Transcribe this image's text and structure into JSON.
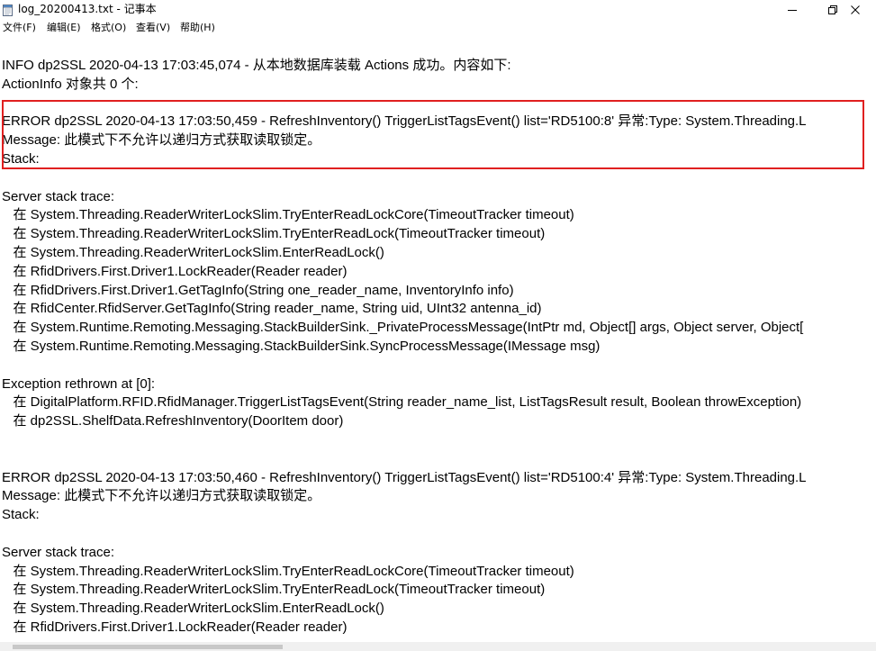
{
  "window": {
    "title": "log_20200413.txt - 记事本"
  },
  "menu": {
    "items": [
      {
        "label": "文件(F)"
      },
      {
        "label": "编辑(E)"
      },
      {
        "label": "格式(O)"
      },
      {
        "label": "查看(V)"
      },
      {
        "label": "帮助(H)"
      }
    ]
  },
  "icons": {
    "app": "notepad-icon",
    "minimize": "minimize-icon",
    "maximize": "maximize-icon",
    "close": "close-icon"
  },
  "colors": {
    "highlight_border": "#e02020",
    "text": "#000000",
    "background": "#ffffff"
  },
  "content": {
    "lines": [
      "INFO dp2SSL 2020-04-13 17:03:45,074 - 从本地数据库装载 Actions 成功。内容如下:",
      "ActionInfo 对象共 0 个:",
      "",
      "ERROR dp2SSL 2020-04-13 17:03:50,459 - RefreshInventory() TriggerListTagsEvent() list='RD5100:8' 异常:Type: System.Threading.L",
      "Message: 此模式下不允许以递归方式获取读取锁定。",
      "Stack:",
      "",
      "Server stack trace:",
      "   在 System.Threading.ReaderWriterLockSlim.TryEnterReadLockCore(TimeoutTracker timeout)",
      "   在 System.Threading.ReaderWriterLockSlim.TryEnterReadLock(TimeoutTracker timeout)",
      "   在 System.Threading.ReaderWriterLockSlim.EnterReadLock()",
      "   在 RfidDrivers.First.Driver1.LockReader(Reader reader)",
      "   在 RfidDrivers.First.Driver1.GetTagInfo(String one_reader_name, InventoryInfo info)",
      "   在 RfidCenter.RfidServer.GetTagInfo(String reader_name, String uid, UInt32 antenna_id)",
      "   在 System.Runtime.Remoting.Messaging.StackBuilderSink._PrivateProcessMessage(IntPtr md, Object[] args, Object server, Object[",
      "   在 System.Runtime.Remoting.Messaging.StackBuilderSink.SyncProcessMessage(IMessage msg)",
      "",
      "Exception rethrown at [0]:",
      "   在 DigitalPlatform.RFID.RfidManager.TriggerListTagsEvent(String reader_name_list, ListTagsResult result, Boolean throwException)",
      "   在 dp2SSL.ShelfData.RefreshInventory(DoorItem door)",
      "",
      "",
      "ERROR dp2SSL 2020-04-13 17:03:50,460 - RefreshInventory() TriggerListTagsEvent() list='RD5100:4' 异常:Type: System.Threading.L",
      "Message: 此模式下不允许以递归方式获取读取锁定。",
      "Stack:",
      "",
      "Server stack trace:",
      "   在 System.Threading.ReaderWriterLockSlim.TryEnterReadLockCore(TimeoutTracker timeout)",
      "   在 System.Threading.ReaderWriterLockSlim.TryEnterReadLock(TimeoutTracker timeout)",
      "   在 System.Threading.ReaderWriterLockSlim.EnterReadLock()",
      "   在 RfidDrivers.First.Driver1.LockReader(Reader reader)"
    ]
  }
}
